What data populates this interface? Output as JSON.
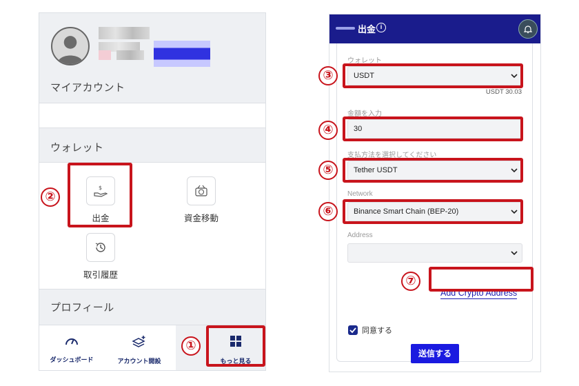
{
  "left_panel": {
    "my_account_heading": "マイアカウント",
    "wallet_heading": "ウォレット",
    "withdraw_label": "出金",
    "transfer_label": "資金移動",
    "history_label": "取引履歴",
    "profile_heading": "プロフィール",
    "nav": {
      "dashboard": "ダッシュボード",
      "open_account": "アカウント開設",
      "more": "もっと見る"
    }
  },
  "right_panel": {
    "title": "出金",
    "wallet_label": "ウォレット",
    "wallet_value": "USDT",
    "balance": "USDT 30.03",
    "amount_label": "金額を入力",
    "amount_value": "30",
    "payment_label": "支払方法を選択してください",
    "payment_value": "Tether USDT",
    "network_label": "Network",
    "network_value": "Binance Smart Chain (BEP-20)",
    "address_label": "Address",
    "address_value": "",
    "add_crypto_link": "Add Crypto Address",
    "agree_label": "同意する",
    "submit_label": "送信する"
  },
  "annotations": {
    "n1": "①",
    "n2": "②",
    "n3": "③",
    "n4": "④",
    "n5": "⑤",
    "n6": "⑥",
    "n7": "⑦"
  },
  "colors": {
    "highlight": "#c8141c",
    "topbar": "#1a1c8c",
    "submit": "#1a1ae0"
  },
  "icons": [
    "user-avatar-icon",
    "withdraw-icon",
    "transfer-icon",
    "history-icon",
    "dashboard-gauge-icon",
    "account-open-icon",
    "grid-icon",
    "info-icon",
    "bell-icon",
    "chevron-down-icon",
    "check-icon"
  ]
}
